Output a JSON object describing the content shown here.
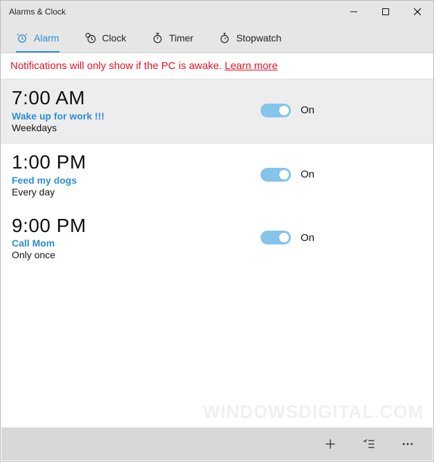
{
  "window": {
    "title": "Alarms & Clock"
  },
  "tabs": [
    {
      "label": "Alarm"
    },
    {
      "label": "Clock"
    },
    {
      "label": "Timer"
    },
    {
      "label": "Stopwatch"
    }
  ],
  "notice": {
    "text": "Notifications will only show if the PC is awake. ",
    "link_label": "Learn more"
  },
  "alarms": [
    {
      "time": "7:00 AM",
      "name": "Wake up for work !!!",
      "repeat": "Weekdays",
      "state_label": "On"
    },
    {
      "time": "1:00 PM",
      "name": "Feed my dogs",
      "repeat": "Every day",
      "state_label": "On"
    },
    {
      "time": "9:00 PM",
      "name": "Call Mom",
      "repeat": "Only once",
      "state_label": "On"
    }
  ],
  "watermark": "WINDOWSDIGITAL.COM"
}
